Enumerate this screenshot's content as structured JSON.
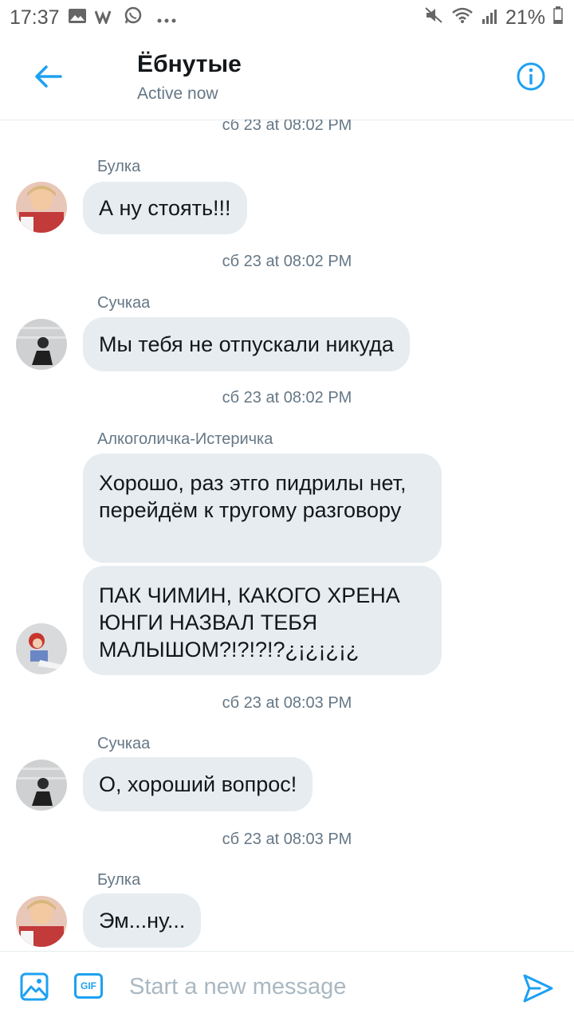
{
  "status_bar": {
    "time": "17:37",
    "left_icons": [
      "gallery-icon",
      "vk-icon",
      "whatsapp-icon",
      "more-dots-icon"
    ],
    "battery": "21%"
  },
  "header": {
    "title": "Ёбнутые",
    "subtitle": "Active now"
  },
  "messages": [
    {
      "timestamp": "сб 23 at 08:02 PM",
      "sender": "Булка",
      "bubbles": [
        "А ну стоять!!!"
      ]
    },
    {
      "timestamp": "сб 23 at 08:02 PM",
      "sender": "Сучкаа",
      "bubbles": [
        "Мы тебя не отпускали никуда"
      ]
    },
    {
      "timestamp": "сб 23 at 08:02 PM",
      "sender": "Алкоголичка-Истеричка",
      "bubbles": [
        "Хорошо, раз этго пидрилы нет, перейдём к тругому разговору",
        "ПАК ЧИМИН, КАКОГО ХРЕНА ЮНГИ НАЗВАЛ ТЕБЯ МАЛЫШОМ?!?!?!?¿¡¿¡¿¡¿"
      ]
    },
    {
      "timestamp": "сб 23 at 08:03 PM",
      "sender": "Сучкаа",
      "bubbles": [
        "О, хороший вопрос!"
      ]
    },
    {
      "timestamp": "сб 23 at 08:03 PM",
      "sender": "Булка",
      "bubbles": [
        "Эм...ну..."
      ]
    }
  ],
  "composer": {
    "placeholder": "Start a new message",
    "gif_label": "GIF"
  },
  "colors": {
    "accent": "#1da1f2",
    "bubble": "#e6ecf0",
    "secondary_text": "#657786"
  }
}
